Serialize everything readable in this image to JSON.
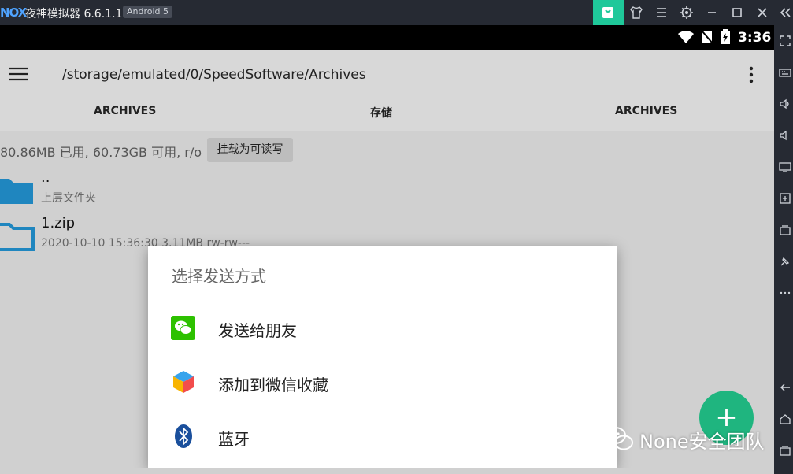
{
  "titlebar": {
    "logo": "NOX",
    "app_title": "夜神模拟器 6.6.1.1",
    "android_badge": "Android 5",
    "bag_color": "#1fc89a"
  },
  "statusbar": {
    "time": "3:36"
  },
  "appbar": {
    "path": "/storage/emulated/0/SpeedSoftware/Archives",
    "tabs": [
      "ARCHIVES",
      "存储",
      "ARCHIVES"
    ],
    "active_tab": 0,
    "accent": "#1679a6"
  },
  "content": {
    "storage_info": "80.86MB 已用, 60.73GB 可用, r/o",
    "mount_button": "挂载为可读写",
    "rows": [
      {
        "title": "..",
        "subtitle": "上层文件夹"
      },
      {
        "title": "1.zip",
        "subtitle": "2020-10-10 15:36:30 3.11MB rw-rw---"
      }
    ]
  },
  "dialog": {
    "title": "选择发送方式",
    "options": [
      {
        "label": "发送给朋友",
        "icon": "wechat-icon"
      },
      {
        "label": "添加到微信收藏",
        "icon": "wechat-favorites-icon"
      },
      {
        "label": "蓝牙",
        "icon": "bluetooth-icon"
      }
    ]
  },
  "fab": {
    "symbol": "+",
    "color": "#1fb57f"
  },
  "watermark": {
    "text": "None安全团队"
  }
}
